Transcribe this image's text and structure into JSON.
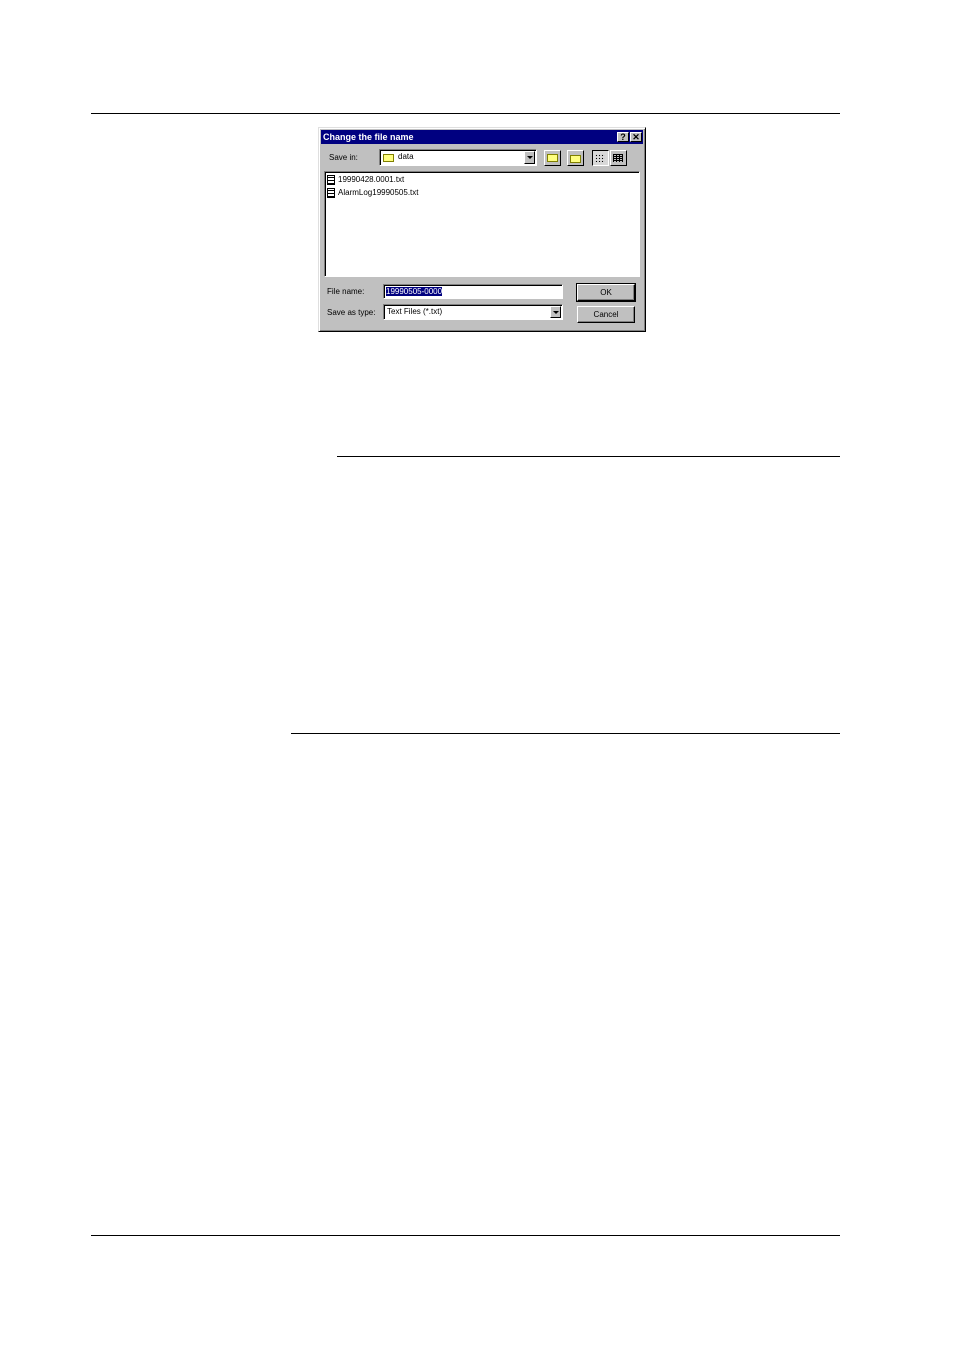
{
  "dialog": {
    "title": "Change the file name",
    "help_label": "?",
    "close_label": "✕",
    "save_in_label": "Save in:",
    "save_in_value": "data",
    "files": [
      "19990428.0001.txt",
      "AlarmLog19990505.txt"
    ],
    "file_name_label": "File name:",
    "file_name_value": "19990505-0000",
    "save_as_type_label": "Save as type:",
    "save_as_type_value": "Text Files (*.txt)",
    "ok_label": "OK",
    "cancel_label": "Cancel"
  }
}
